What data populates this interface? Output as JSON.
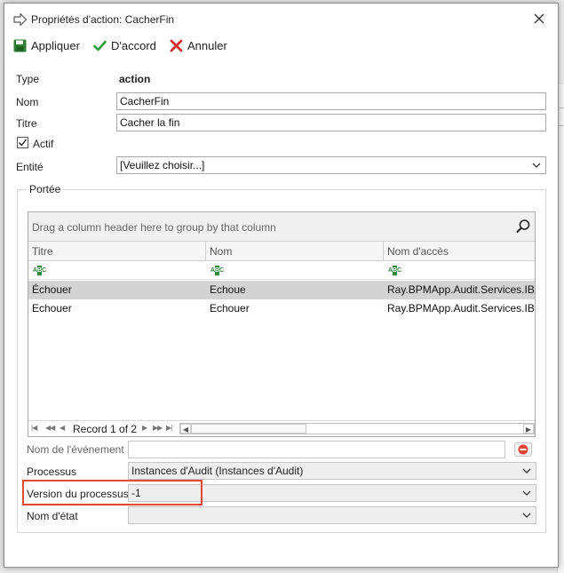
{
  "window": {
    "title": "Propriétés d'action: CacherFin"
  },
  "toolbar": {
    "apply_label": "Appliquer",
    "ok_label": "D'accord",
    "cancel_label": "Annuler"
  },
  "form": {
    "type_label": "Type",
    "type_value": "action",
    "name_label": "Nom",
    "name_value": "CacherFin",
    "title_label": "Titre",
    "title_value": "Cacher la fin",
    "active_label": "Actif",
    "active_checked": true,
    "entity_label": "Entité",
    "entity_value": "[Veuillez choisir...]"
  },
  "scope": {
    "legend": "Portée",
    "grid": {
      "group_hint": "Drag a column header here to group by that column",
      "columns": [
        "Titre",
        "Nom",
        "Nom d'accès"
      ],
      "rows": [
        {
          "titre": "Échouer",
          "nom": "Echoue",
          "acces": "Ray.BPMApp.Audit.Services.IBPMA",
          "selected": true
        },
        {
          "titre": "Echouer",
          "nom": "Echouer",
          "acces": "Ray.BPMApp.Audit.Services.IBPMA",
          "selected": false
        }
      ],
      "record_text": "Record 1 of 2"
    },
    "event_name_label": "Nom de l'événement",
    "process_label": "Processus",
    "process_value": "Instances d'Audit (Instances d'Audit)",
    "process_version_label": "Version du processus",
    "process_version_value": "-1",
    "state_name_label": "Nom d'état",
    "state_name_value": ""
  },
  "colors": {
    "apply_icon": "#2e7d32",
    "ok_icon": "#2e9e3a",
    "cancel_icon": "#d3302f",
    "highlight_box": "#e04b34",
    "selected_row": "#d3d3d3"
  },
  "icons": {
    "title": "arrow-right-icon",
    "close": "close-icon",
    "apply": "save-icon",
    "ok": "checkmark-icon",
    "cancel": "x-icon",
    "search": "search-icon",
    "chevron": "chevron-down-icon",
    "clear": "clear-red-icon"
  }
}
